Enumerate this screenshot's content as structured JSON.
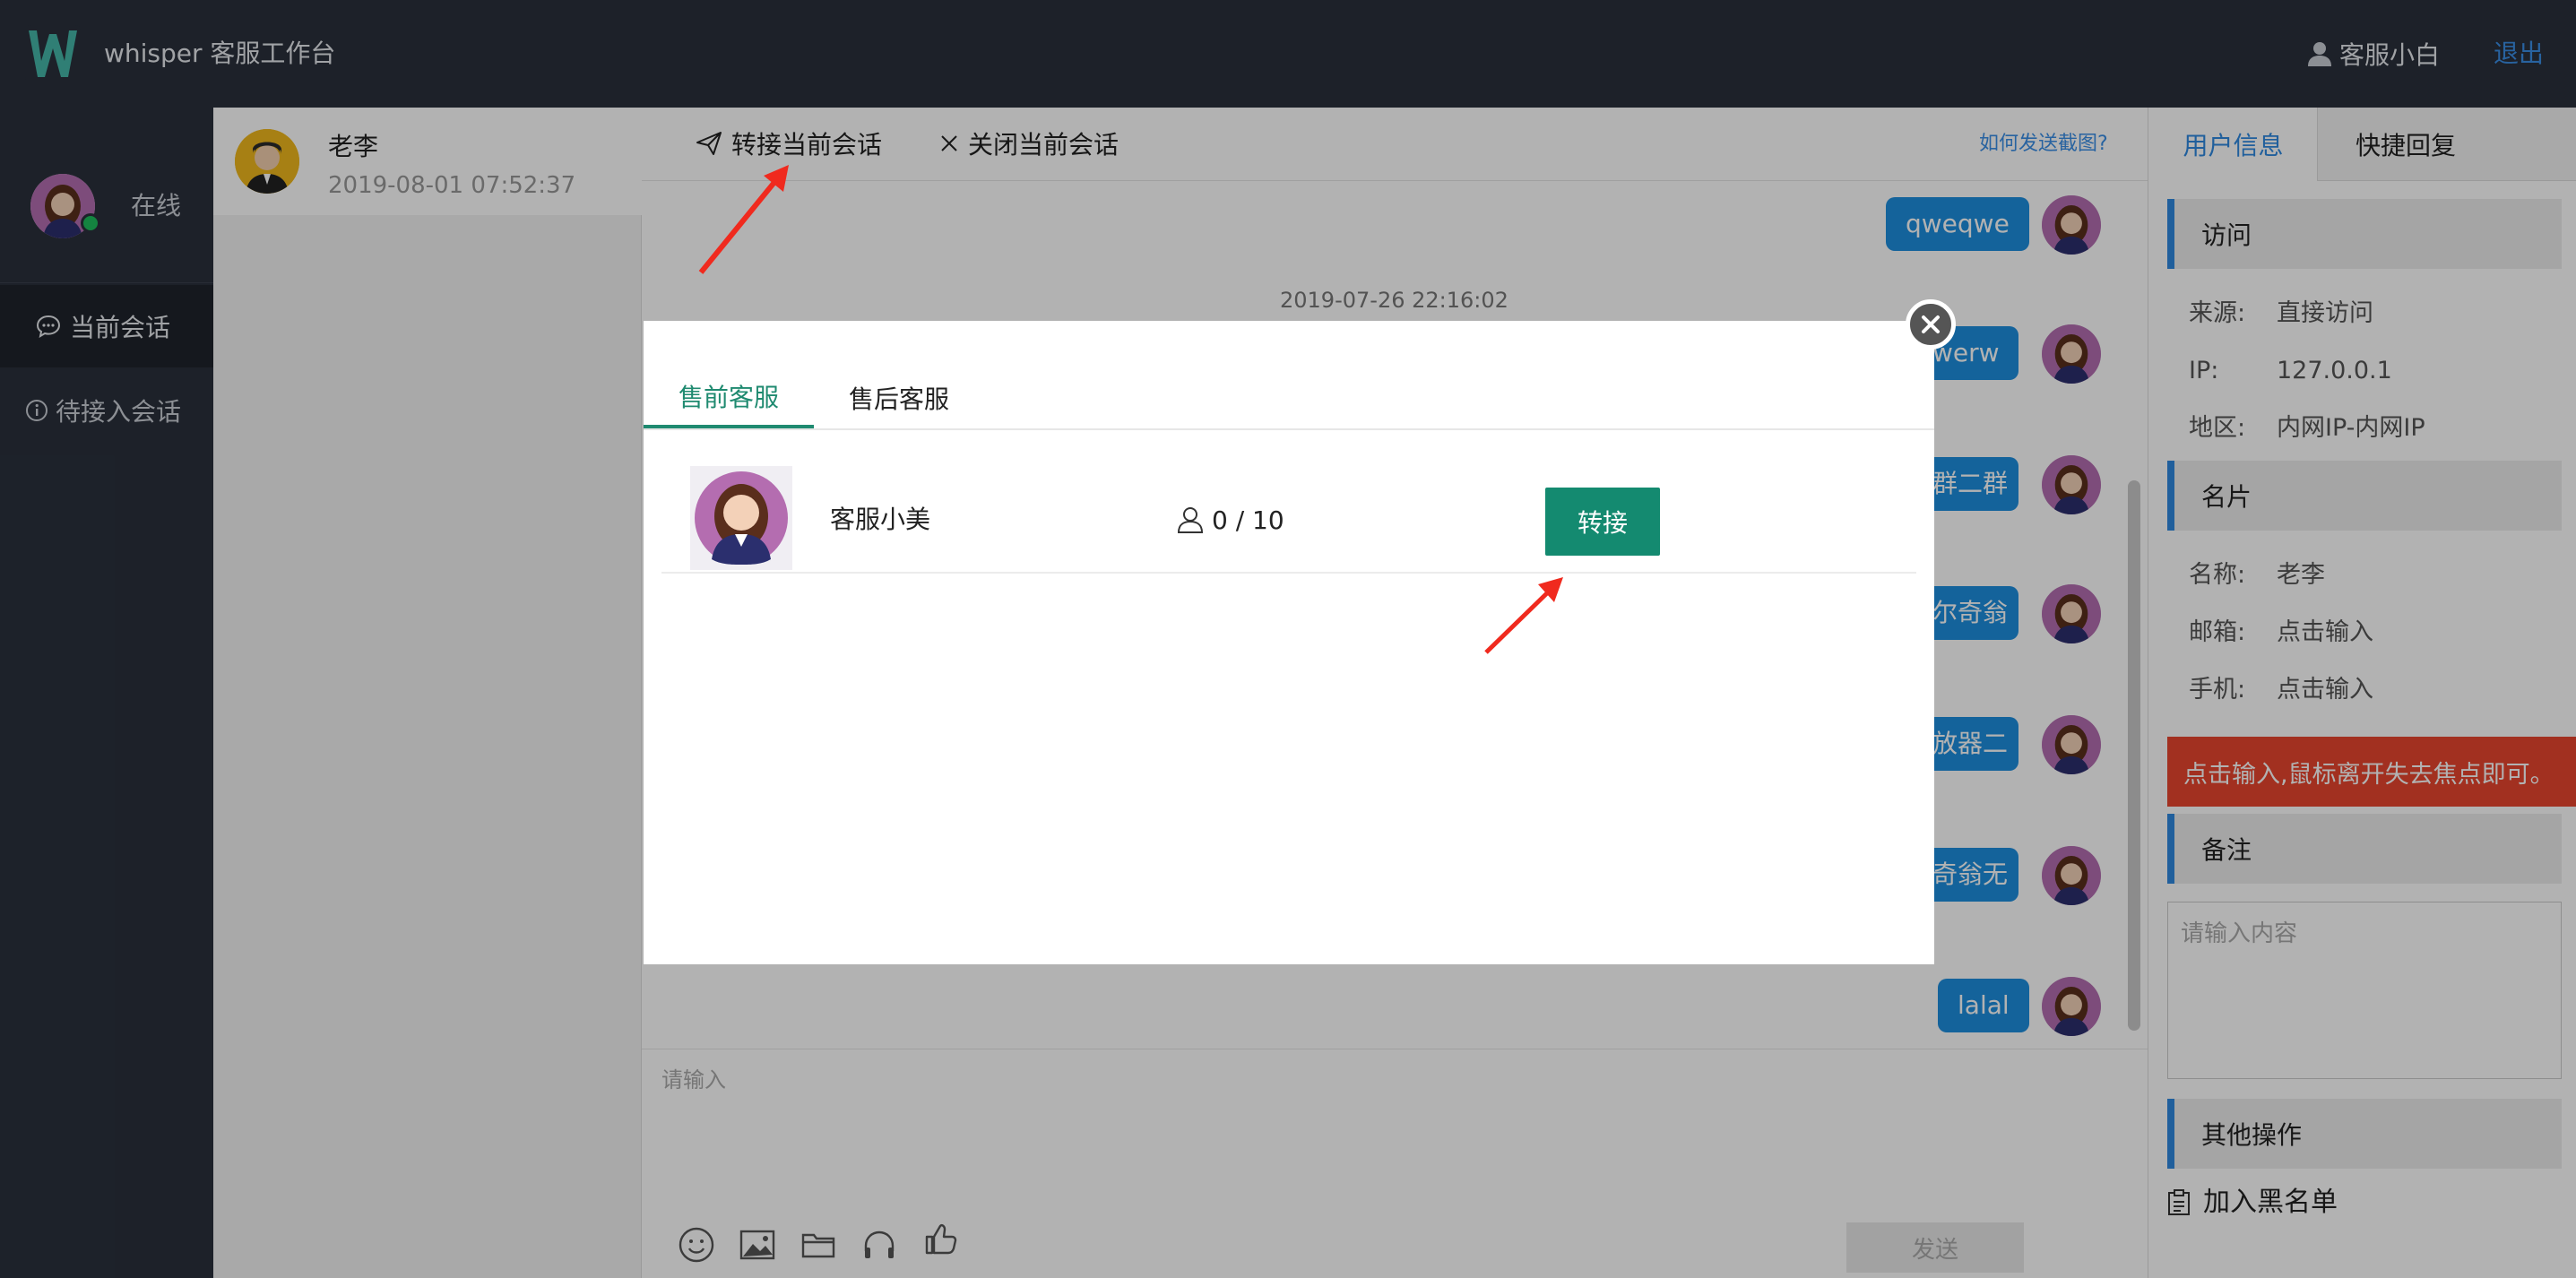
{
  "header": {
    "app_title": "whisper 客服工作台",
    "agent_name": "客服小白",
    "logout": "退出"
  },
  "nav": {
    "status": "在线",
    "current_sessions": "当前会话",
    "waiting_sessions": "待接入会话"
  },
  "session_list": [
    {
      "name": "老李",
      "time": "2019-08-01 07:52:37"
    }
  ],
  "toolbar": {
    "transfer": "转接当前会话",
    "close": "关闭当前会话",
    "screenshot_help": "如何发送截图?"
  },
  "chat": {
    "timestamp": "2019-07-26 22:16:02",
    "messages": [
      "qweqwe",
      "werw",
      "群二群",
      "尔奇翁",
      "放器二",
      "奇翁无",
      "lalal"
    ],
    "input_placeholder": "请输入",
    "send": "发送",
    "tools": [
      "emoji-icon",
      "image-icon",
      "folder-icon",
      "headset-icon",
      "thumbs-up-icon"
    ]
  },
  "right_panel": {
    "tabs": [
      "用户信息",
      "快捷回复"
    ],
    "visit": {
      "title": "访问",
      "source_label": "来源:",
      "source": "直接访问",
      "ip_label": "IP:",
      "ip": "127.0.0.1",
      "region_label": "地区:",
      "region": "内网IP-内网IP"
    },
    "card": {
      "title": "名片",
      "name_label": "名称:",
      "name": "老李",
      "email_label": "邮箱:",
      "email": "点击输入",
      "phone_label": "手机:",
      "phone": "点击输入"
    },
    "hint": "点击输入,鼠标离开失去焦点即可。",
    "remark": {
      "title": "备注",
      "placeholder": "请输入内容"
    },
    "other": {
      "title": "其他操作",
      "blacklist": "加入黑名单"
    }
  },
  "modal": {
    "tabs": [
      "售前客服",
      "售后客服"
    ],
    "active_tab": 0,
    "agents": [
      {
        "name": "客服小美",
        "load": "0 / 10",
        "action": "转接"
      }
    ]
  },
  "colors": {
    "header_bg": "#2a303c",
    "accent_blue": "#2f89e0",
    "accent_green": "#148a70",
    "hint_red": "#e8462e",
    "bubble": "#1e8ede"
  }
}
